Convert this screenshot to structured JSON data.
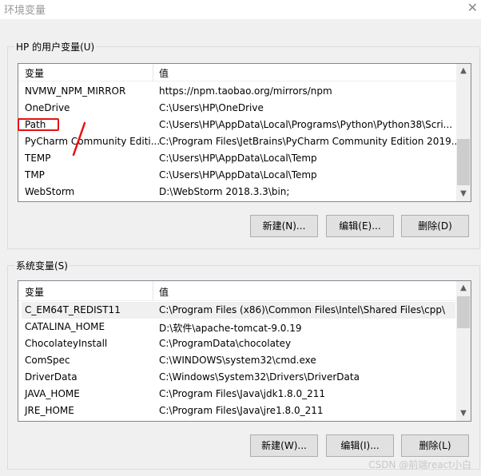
{
  "window": {
    "title": "环境变量",
    "close_icon": "close-icon"
  },
  "user_vars": {
    "label": "HP 的用户变量(U)",
    "columns": [
      "变量",
      "值"
    ],
    "rows": [
      {
        "name": "NVMW_NPM_MIRROR",
        "value": "https://npm.taobao.org/mirrors/npm"
      },
      {
        "name": "OneDrive",
        "value": "C:\\Users\\HP\\OneDrive"
      },
      {
        "name": "Path",
        "value": "C:\\Users\\HP\\AppData\\Local\\Programs\\Python\\Python38\\Scri..."
      },
      {
        "name": "PyCharm Community Editi...",
        "value": "C:\\Program Files\\JetBrains\\PyCharm Community Edition 2019...."
      },
      {
        "name": "TEMP",
        "value": "C:\\Users\\HP\\AppData\\Local\\Temp"
      },
      {
        "name": "TMP",
        "value": "C:\\Users\\HP\\AppData\\Local\\Temp"
      },
      {
        "name": "WebStorm",
        "value": "D:\\WebStorm 2018.3.3\\bin;"
      }
    ],
    "buttons": {
      "new": "新建(N)...",
      "edit": "编辑(E)...",
      "delete": "删除(D)"
    }
  },
  "system_vars": {
    "label": "系统变量(S)",
    "columns": [
      "变量",
      "值"
    ],
    "selected_index": 0,
    "rows": [
      {
        "name": "C_EM64T_REDIST11",
        "value": "C:\\Program Files (x86)\\Common Files\\Intel\\Shared Files\\cpp\\"
      },
      {
        "name": "CATALINA_HOME",
        "value": "D:\\软件\\apache-tomcat-9.0.19"
      },
      {
        "name": "ChocolateyInstall",
        "value": "C:\\ProgramData\\chocolatey"
      },
      {
        "name": "ComSpec",
        "value": "C:\\WINDOWS\\system32\\cmd.exe"
      },
      {
        "name": "DriverData",
        "value": "C:\\Windows\\System32\\Drivers\\DriverData"
      },
      {
        "name": "JAVA_HOME",
        "value": "C:\\Program Files\\Java\\jdk1.8.0_211"
      },
      {
        "name": "JRE_HOME",
        "value": "C:\\Program Files\\Java\\jre1.8.0_211"
      }
    ],
    "buttons": {
      "new": "新建(W)...",
      "edit": "编辑(I)...",
      "delete": "删除(L)"
    }
  },
  "watermark": "CSDN @前端react小白",
  "colors": {
    "annotation": "#e81010",
    "selected_row": "#f0f0f0"
  }
}
